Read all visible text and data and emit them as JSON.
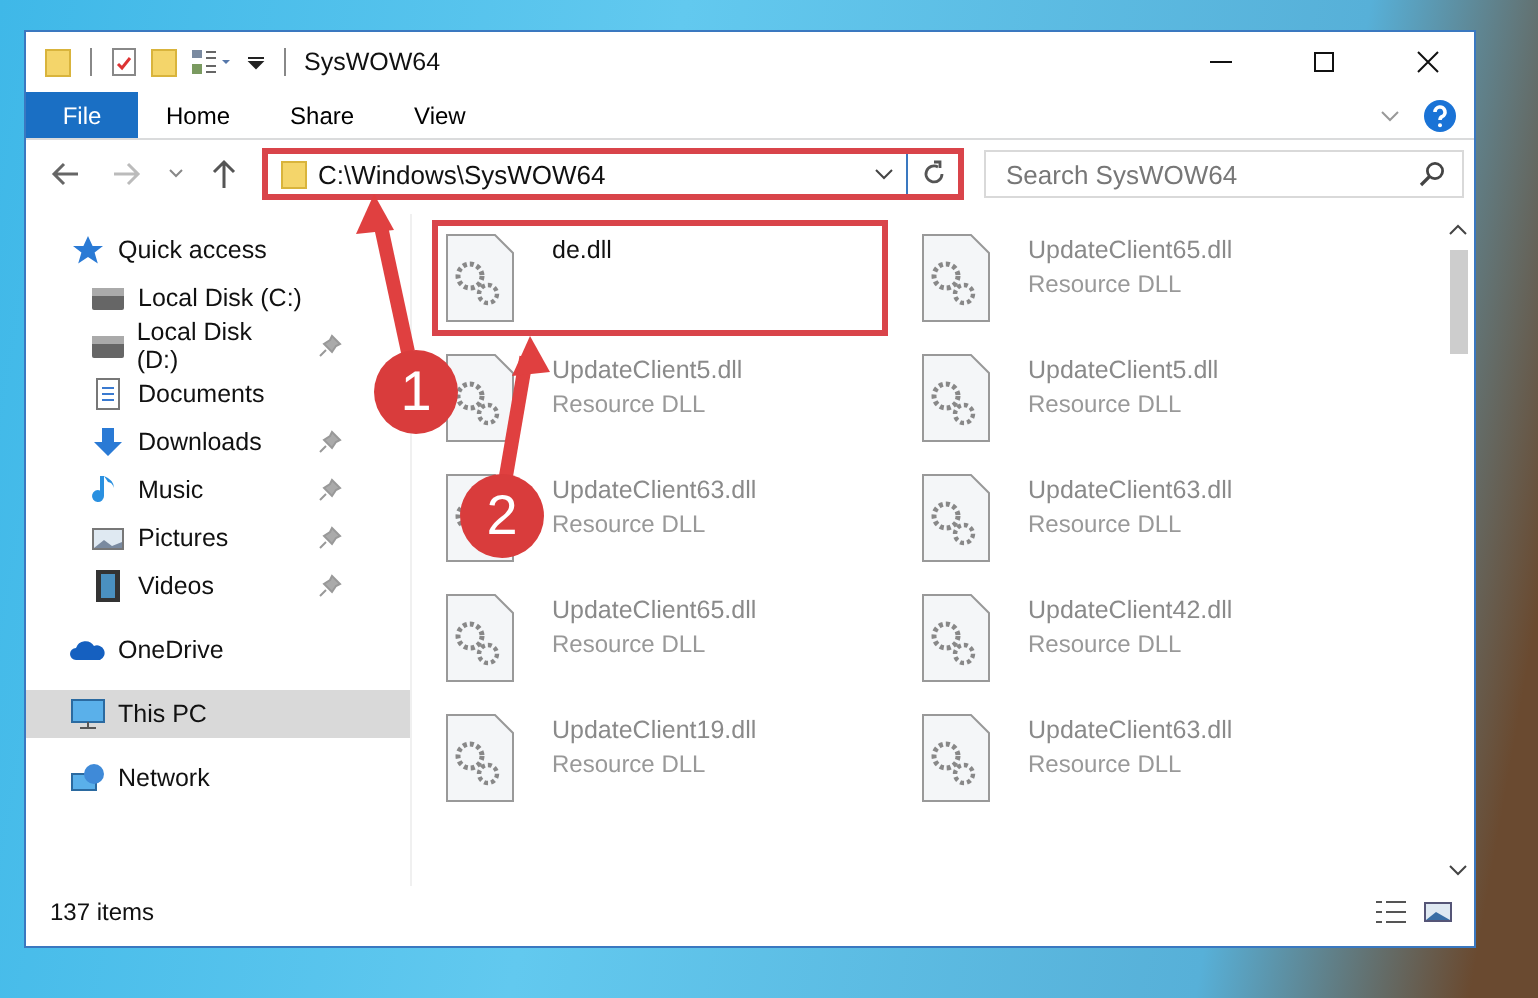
{
  "window": {
    "title": "SysWOW64"
  },
  "ribbon": {
    "file_tab": "File",
    "tabs": [
      {
        "label": "Home"
      },
      {
        "label": "Share"
      },
      {
        "label": "View"
      }
    ]
  },
  "address_bar": {
    "path": "C:\\Windows\\SysWOW64",
    "highlighted": true
  },
  "search": {
    "placeholder": "Search SysWOW64"
  },
  "sidebar": {
    "items": [
      {
        "label": "Quick access",
        "kind": "star",
        "selected": false,
        "children": [
          {
            "label": "Local Disk (C:)",
            "kind": "drive",
            "pinned": false
          },
          {
            "label": "Local Disk (D:)",
            "kind": "drive",
            "pinned": true
          },
          {
            "label": "Documents",
            "kind": "documents",
            "pinned": false
          },
          {
            "label": "Downloads",
            "kind": "downloads",
            "pinned": true
          },
          {
            "label": "Music",
            "kind": "music",
            "pinned": true
          },
          {
            "label": "Pictures",
            "kind": "pictures",
            "pinned": true
          },
          {
            "label": "Videos",
            "kind": "videos",
            "pinned": true
          }
        ]
      },
      {
        "label": "OneDrive",
        "kind": "cloud",
        "selected": false
      },
      {
        "label": "This PC",
        "kind": "computer",
        "selected": true
      },
      {
        "label": "Network",
        "kind": "network",
        "selected": false
      }
    ]
  },
  "files": [
    {
      "name": "de.dll",
      "dimmed": false,
      "highlighted": true
    },
    {
      "name": "UpdateClient65.dll",
      "type": "Resource DLL",
      "dimmed": true,
      "highlighted": false
    },
    {
      "name": "UpdateClient5.dll",
      "type": "Resource DLL",
      "dimmed": true,
      "highlighted": false
    },
    {
      "name": "UpdateClient5.dll",
      "type": "Resource DLL",
      "dimmed": true,
      "highlighted": false
    },
    {
      "name": "UpdateClient63.dll",
      "type": "Resource DLL",
      "dimmed": true,
      "highlighted": false
    },
    {
      "name": "UpdateClient63.dll",
      "type": "Resource DLL",
      "dimmed": true,
      "highlighted": false
    },
    {
      "name": "UpdateClient65.dll",
      "type": "Resource DLL",
      "dimmed": true,
      "highlighted": false
    },
    {
      "name": "UpdateClient42.dll",
      "type": "Resource DLL",
      "dimmed": true,
      "highlighted": false
    },
    {
      "name": "UpdateClient19.dll",
      "type": "Resource DLL",
      "dimmed": true,
      "highlighted": false
    },
    {
      "name": "UpdateClient63.dll",
      "type": "Resource DLL",
      "dimmed": true,
      "highlighted": false
    }
  ],
  "status_bar": {
    "count": "137 items"
  },
  "callouts": [
    {
      "label": "1"
    },
    {
      "label": "2"
    }
  ]
}
